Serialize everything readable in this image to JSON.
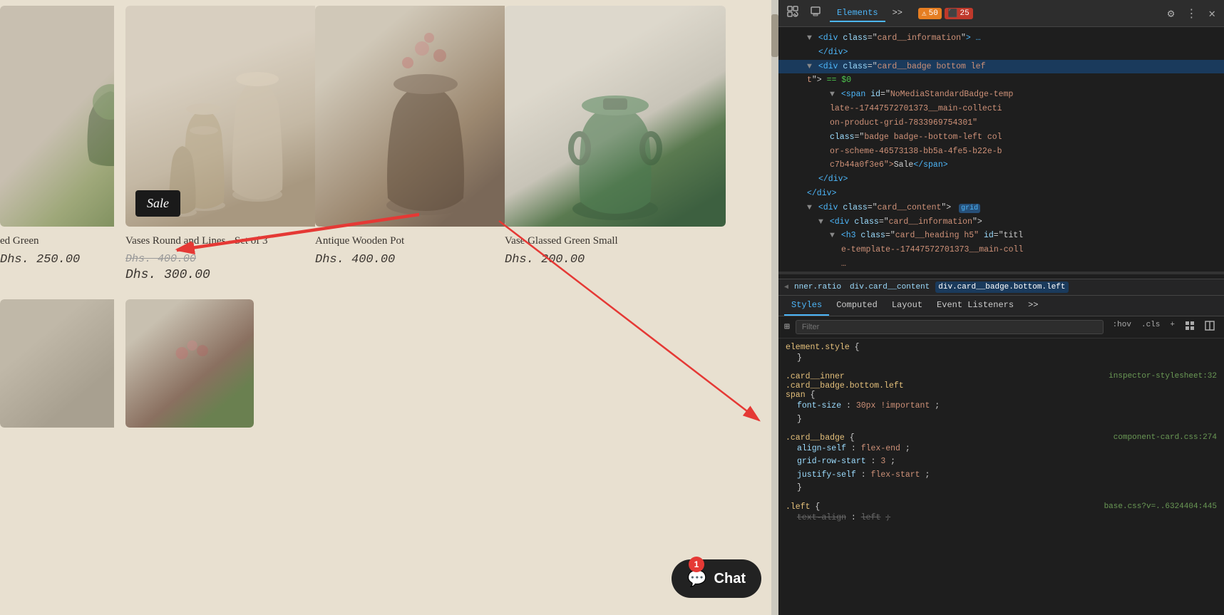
{
  "shop": {
    "background": "#e8e0d0",
    "products": [
      {
        "id": "lavender-green",
        "title": "ed Green",
        "price_regular": "250.00",
        "image_class": "img-lavender",
        "partial": true
      },
      {
        "id": "vases-round",
        "title": "Vases Round and Lines - Set of 3",
        "price_original": "Dhs. 400.00",
        "price_sale": "Dhs. 300.00",
        "image_class": "img-vases",
        "has_sale": true
      },
      {
        "id": "wooden-pot",
        "title": "Antique Wooden Pot",
        "price_regular": "Dhs. 400.00",
        "image_class": "img-wooden-pot"
      },
      {
        "id": "green-vase",
        "title": "Vase Glassed Green Small",
        "price_regular": "Dhs. 200.00",
        "image_class": "img-green-vase"
      }
    ],
    "bottom_products": [
      {
        "id": "bottom1",
        "image_class": "img-bottom1",
        "partial": true
      },
      {
        "id": "bottom2",
        "image_class": "img-bottom2"
      }
    ],
    "sale_label": "Sale",
    "chat_label": "Chat",
    "chat_badge": "1"
  },
  "devtools": {
    "tabs": [
      "Elements",
      ">>"
    ],
    "active_tab": "Elements",
    "warnings": "50",
    "errors": "25",
    "html_lines": [
      {
        "indent": 1,
        "content": "<div class=\"card__information\">"
      },
      {
        "indent": 2,
        "content": "</div>"
      },
      {
        "indent": 1,
        "content": "<div class=\"card__badge bottom lef"
      },
      {
        "indent": 1,
        "content": "t\"> == $0"
      },
      {
        "indent": 3,
        "content": "<span id=\"NoMediaStandardBadge-temp"
      },
      {
        "indent": 3,
        "content": "late--17447572701373__main-collecti"
      },
      {
        "indent": 3,
        "content": "on-product-grid-7833969754301\""
      },
      {
        "indent": 3,
        "content": "class=\"badge badge--bottom-left col"
      },
      {
        "indent": 3,
        "content": "or-scheme-46573138-bb5a-4fe5-b22e-b"
      },
      {
        "indent": 3,
        "content": "c7b44a0f3e6\">Sale</span>"
      },
      {
        "indent": 2,
        "content": "</div>"
      },
      {
        "indent": 1,
        "content": "</div>"
      },
      {
        "indent": 1,
        "content": "<div class=\"card__content\">"
      },
      {
        "indent": 2,
        "content": "<div class=\"card__information\">"
      },
      {
        "indent": 3,
        "content": "<h3 class=\"card__heading h5\" id=\"titl"
      },
      {
        "indent": 3,
        "content": "e-template--17447572701373__main-coll"
      },
      {
        "indent": 3,
        "content": "..."
      }
    ],
    "breadcrumb": [
      {
        "label": "nner.ratio",
        "active": false
      },
      {
        "label": "div.card__content",
        "active": false
      },
      {
        "label": "div.card__badge.bottom.left",
        "active": true
      }
    ],
    "style_tabs": [
      "Styles",
      "Computed",
      "Layout",
      "Event Listeners",
      ">>"
    ],
    "active_style_tab": "Styles",
    "filter_placeholder": "Filter",
    "filter_hov": ":hov",
    "filter_cls": ".cls",
    "css_rules": [
      {
        "selector": "element.style {",
        "source": "",
        "props": [
          {
            "prop": "",
            "val": "",
            "comment": "}"
          }
        ]
      },
      {
        "selector": ".card__inner",
        "selector2": ".card__badge.bottom.left",
        "selector3": "span {",
        "source": "inspector-stylesheet:32",
        "props": [
          {
            "prop": "font-size",
            "val": "30px !important",
            "semi": ";"
          }
        ]
      },
      {
        "selector": ".card__badge {",
        "source": "component-card.css:274",
        "props": [
          {
            "prop": "align-self",
            "val": "flex-end",
            "semi": ";"
          },
          {
            "prop": "grid-row-start",
            "val": "3",
            "semi": ";"
          },
          {
            "prop": "justify-self",
            "val": "flex-start",
            "semi": ";"
          }
        ]
      },
      {
        "selector": ".left {",
        "source": "base.css?v=..6324404:445",
        "props": [
          {
            "prop": "text-align",
            "val": "left",
            "semi": ";"
          }
        ]
      }
    ],
    "computed_label": "Computed"
  }
}
